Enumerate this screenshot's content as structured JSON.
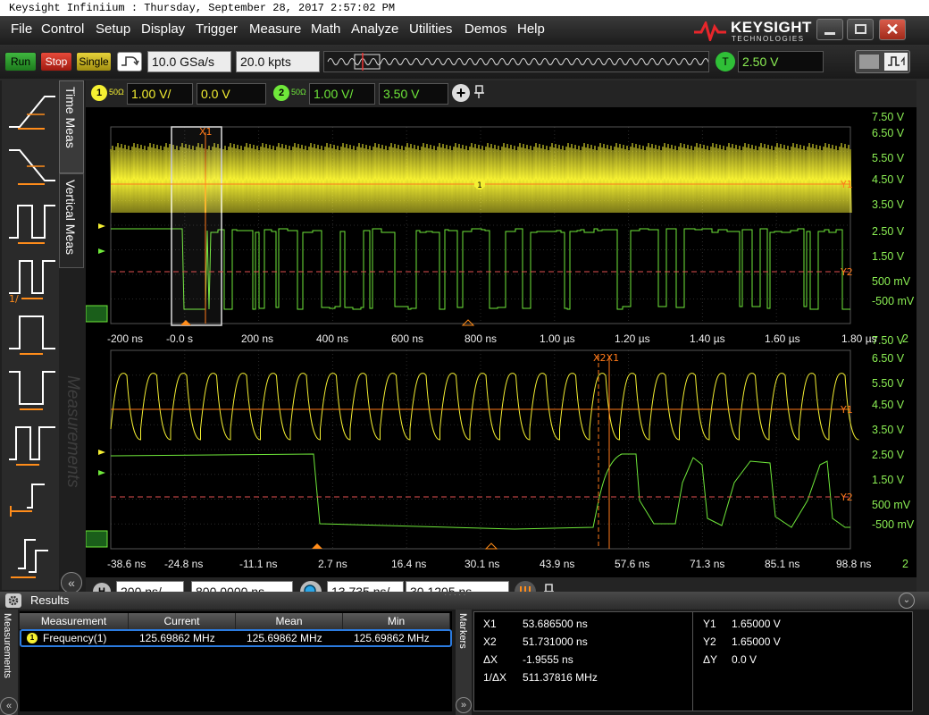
{
  "window": {
    "title": "Keysight Infiniium : Thursday, September 28, 2017 2:57:02 PM"
  },
  "menu": [
    "File",
    "Control",
    "Setup",
    "Display",
    "Trigger",
    "Measure",
    "Math",
    "Analyze",
    "Utilities",
    "Demos",
    "Help"
  ],
  "brand": {
    "name": "KEYSIGHT",
    "sub": "TECHNOLOGIES"
  },
  "toolbar": {
    "run": "Run",
    "stop": "Stop",
    "single": "Single",
    "sample_rate": "10.0 GSa/s",
    "memory_depth": "20.0 kpts",
    "trigger_badge": "T",
    "trigger_level": "2.50 V"
  },
  "channels": {
    "ch1": {
      "num": "1",
      "impedance": "50Ω",
      "scale": "1.00 V/",
      "offset": "0.0 V"
    },
    "ch2": {
      "num": "2",
      "impedance": "50Ω",
      "scale": "1.00 V/",
      "offset": "3.50 V"
    }
  },
  "left_tabs": {
    "time": "Time Meas",
    "vertical": "Vertical Meas",
    "measurements": "Measurements"
  },
  "main_view": {
    "y_labels": [
      "7.50 V",
      "6.50 V",
      "5.50 V",
      "4.50 V",
      "3.50 V",
      "2.50 V",
      "1.50 V",
      "500 mV",
      "-500 mV"
    ],
    "x_labels": [
      "-200 ns",
      "-0.0 s",
      "200 ns",
      "400 ns",
      "600 ns",
      "800 ns",
      "1.00 µs",
      "1.20 µs",
      "1.40 µs",
      "1.60 µs",
      "1.80 µs"
    ],
    "x_suffix": "2",
    "x1_marker": "X1",
    "y1_marker": "Y1",
    "y2_marker": "Y2"
  },
  "zoom_view": {
    "y_labels": [
      "7.50 V",
      "6.50 V",
      "5.50 V",
      "4.50 V",
      "3.50 V",
      "2.50 V",
      "1.50 V",
      "500 mV",
      "-500 mV"
    ],
    "x_labels": [
      "-38.6 ns",
      "-24.8 ns",
      "-11.1 ns",
      "2.7 ns",
      "16.4 ns",
      "30.1 ns",
      "43.9 ns",
      "57.6 ns",
      "71.3 ns",
      "85.1 ns",
      "98.8 ns"
    ],
    "x_suffix": "2",
    "x2x1_marker": "X2X1",
    "y1_marker": "Y1",
    "y2_marker": "Y2"
  },
  "horizontal": {
    "badge": "H",
    "scale": "200 ns/",
    "position": "800.0000 ns",
    "zoom_scale": "13.735 ns/",
    "zoom_position": "30.1205 ns"
  },
  "results": {
    "title": "Results",
    "side_label": "Measurements",
    "headers": [
      "Measurement",
      "Current",
      "Mean",
      "Min"
    ],
    "rows": [
      {
        "badge": "1",
        "name": "Frequency(1)",
        "current": "125.69862 MHz",
        "mean": "125.69862 MHz",
        "min": "125.69862 MHz"
      }
    ]
  },
  "markers": {
    "title": "Markers",
    "x1_label": "X1",
    "x1": "53.686500 ns",
    "x2_label": "X2",
    "x2": "51.731000 ns",
    "dx_label": "ΔX",
    "dx": "-1.9555 ns",
    "inv_dx_label": "1/ΔX",
    "inv_dx": "511.37816 MHz",
    "y1_label": "Y1",
    "y1": "1.65000 V",
    "y2_label": "Y2",
    "y2": "1.65000 V",
    "dy_label": "ΔY",
    "dy": "0.0 V"
  },
  "colors": {
    "ch1": "#f5f032",
    "ch2": "#6fe83a",
    "marker": "#ff7a1a",
    "marker_y2": "#e05050"
  }
}
